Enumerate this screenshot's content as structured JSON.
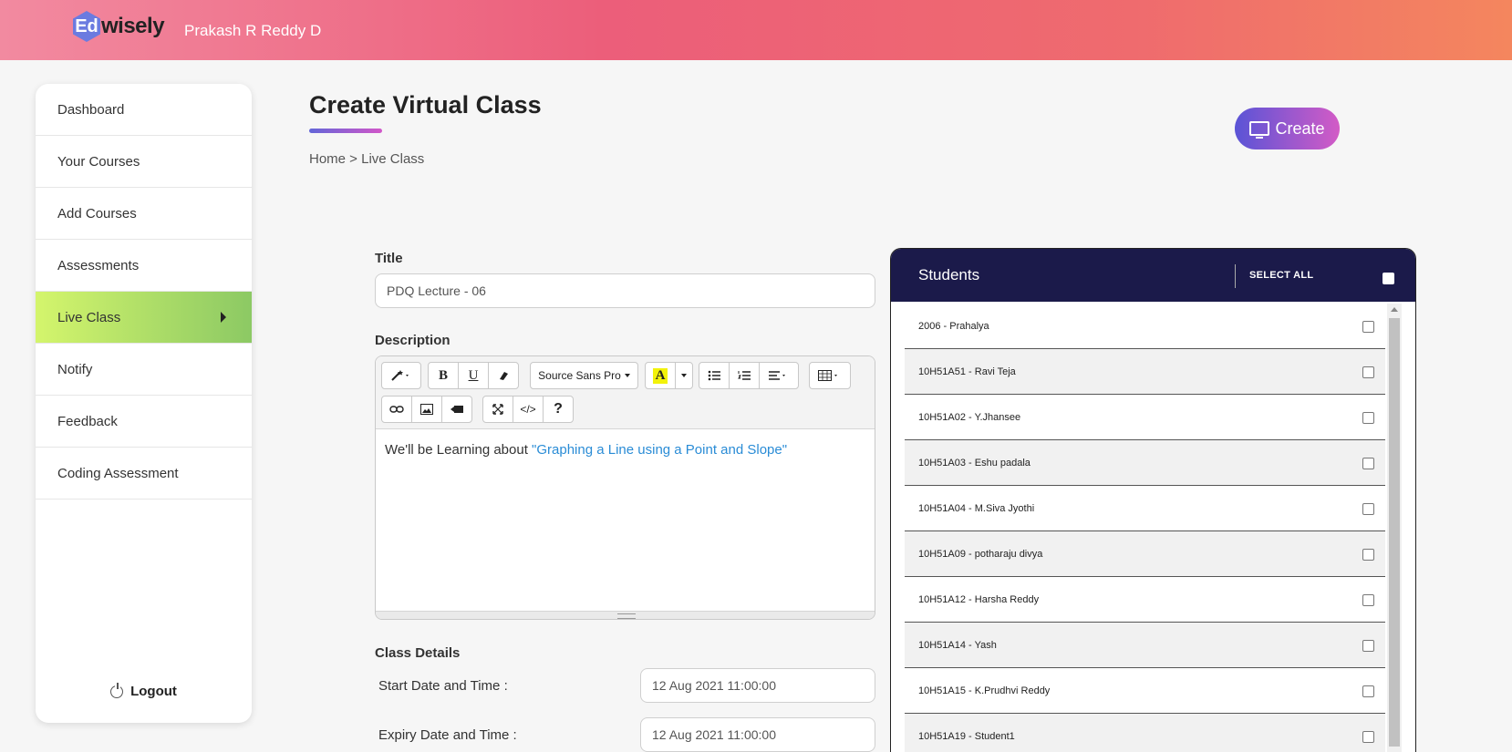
{
  "header": {
    "logo_mark": "Ed",
    "logo_word": "wisely",
    "user_name": "Prakash R Reddy D"
  },
  "sidebar": {
    "items": [
      {
        "label": "Dashboard"
      },
      {
        "label": "Your Courses"
      },
      {
        "label": "Add Courses"
      },
      {
        "label": "Assessments"
      },
      {
        "label": "Live Class",
        "active": true
      },
      {
        "label": "Notify"
      },
      {
        "label": "Feedback"
      },
      {
        "label": "Coding Assessment"
      }
    ],
    "logout": "Logout"
  },
  "page": {
    "title": "Create Virtual Class",
    "breadcrumb": "Home > Live Class",
    "create_label": "Create"
  },
  "form": {
    "title_label": "Title",
    "title_value": "PDQ Lecture - 06",
    "description_label": "Description",
    "toolbar": {
      "font_name": "Source Sans Pro",
      "highlight_letter": "A",
      "help": "?",
      "code": "</>"
    },
    "description_text": "We'll be Learning about ",
    "description_link": "\"Graphing a Line using a Point and Slope\"",
    "class_details_label": "Class Details",
    "start_label": "Start Date and Time :",
    "start_value": "12 Aug 2021 11:00:00",
    "expiry_label": "Expiry Date and Time :",
    "expiry_value": "12 Aug 2021 11:00:00"
  },
  "students": {
    "title": "Students",
    "select_all": "SELECT ALL",
    "list": [
      {
        "name": "2006 - Prahalya"
      },
      {
        "name": "10H51A51 - Ravi Teja"
      },
      {
        "name": "10H51A02 - Y.Jhansee"
      },
      {
        "name": "10H51A03 - Eshu padala"
      },
      {
        "name": "10H51A04 - M.Siva Jyothi"
      },
      {
        "name": "10H51A09 - potharaju divya"
      },
      {
        "name": "10H51A12 - Harsha Reddy"
      },
      {
        "name": "10H51A14 - Yash"
      },
      {
        "name": "10H51A15 - K.Prudhvi Reddy"
      },
      {
        "name": "10H51A19 - Student1"
      }
    ]
  }
}
